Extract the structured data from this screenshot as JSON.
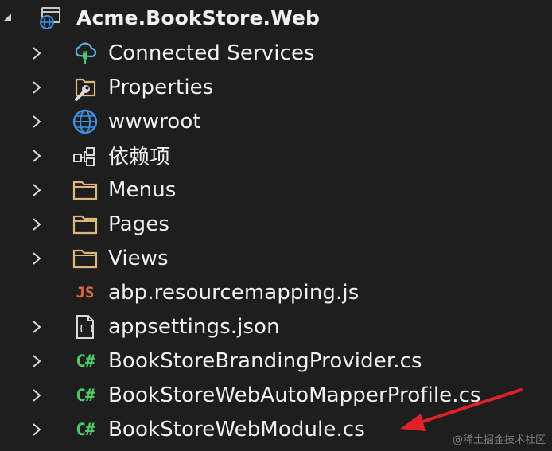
{
  "project": {
    "name": "Acme.BookStore.Web",
    "icon": "web-project-icon",
    "expanded": true
  },
  "items": [
    {
      "label": "Connected Services",
      "icon": "connected-services-icon",
      "expandable": true
    },
    {
      "label": "Properties",
      "icon": "properties-icon",
      "expandable": true
    },
    {
      "label": "wwwroot",
      "icon": "globe-icon",
      "expandable": true
    },
    {
      "label": "依赖项",
      "icon": "dependencies-icon",
      "expandable": true
    },
    {
      "label": "Menus",
      "icon": "folder-icon",
      "expandable": true
    },
    {
      "label": "Pages",
      "icon": "folder-icon",
      "expandable": true
    },
    {
      "label": "Views",
      "icon": "folder-icon",
      "expandable": true
    },
    {
      "label": "abp.resourcemapping.js",
      "icon": "js-file-icon",
      "glyph": "JS",
      "expandable": false
    },
    {
      "label": "appsettings.json",
      "icon": "json-file-icon",
      "glyph": "{ }",
      "expandable": true
    },
    {
      "label": "BookStoreBrandingProvider.cs",
      "icon": "csharp-file-icon",
      "glyph": "C#",
      "expandable": true
    },
    {
      "label": "BookStoreWebAutoMapperProfile.cs",
      "icon": "csharp-file-icon",
      "glyph": "C#",
      "expandable": true
    },
    {
      "label": "BookStoreWebModule.cs",
      "icon": "csharp-file-icon",
      "glyph": "C#",
      "expandable": true
    }
  ],
  "watermark": "@稀土掘金技术社区",
  "colors": {
    "background": "#1e1e1e",
    "text": "#f0f0f0",
    "folder": "#dcb67a",
    "csharp": "#4fc86a",
    "js": "#e0673f",
    "globe": "#3e8fe0",
    "arrow": "#e3202a"
  }
}
